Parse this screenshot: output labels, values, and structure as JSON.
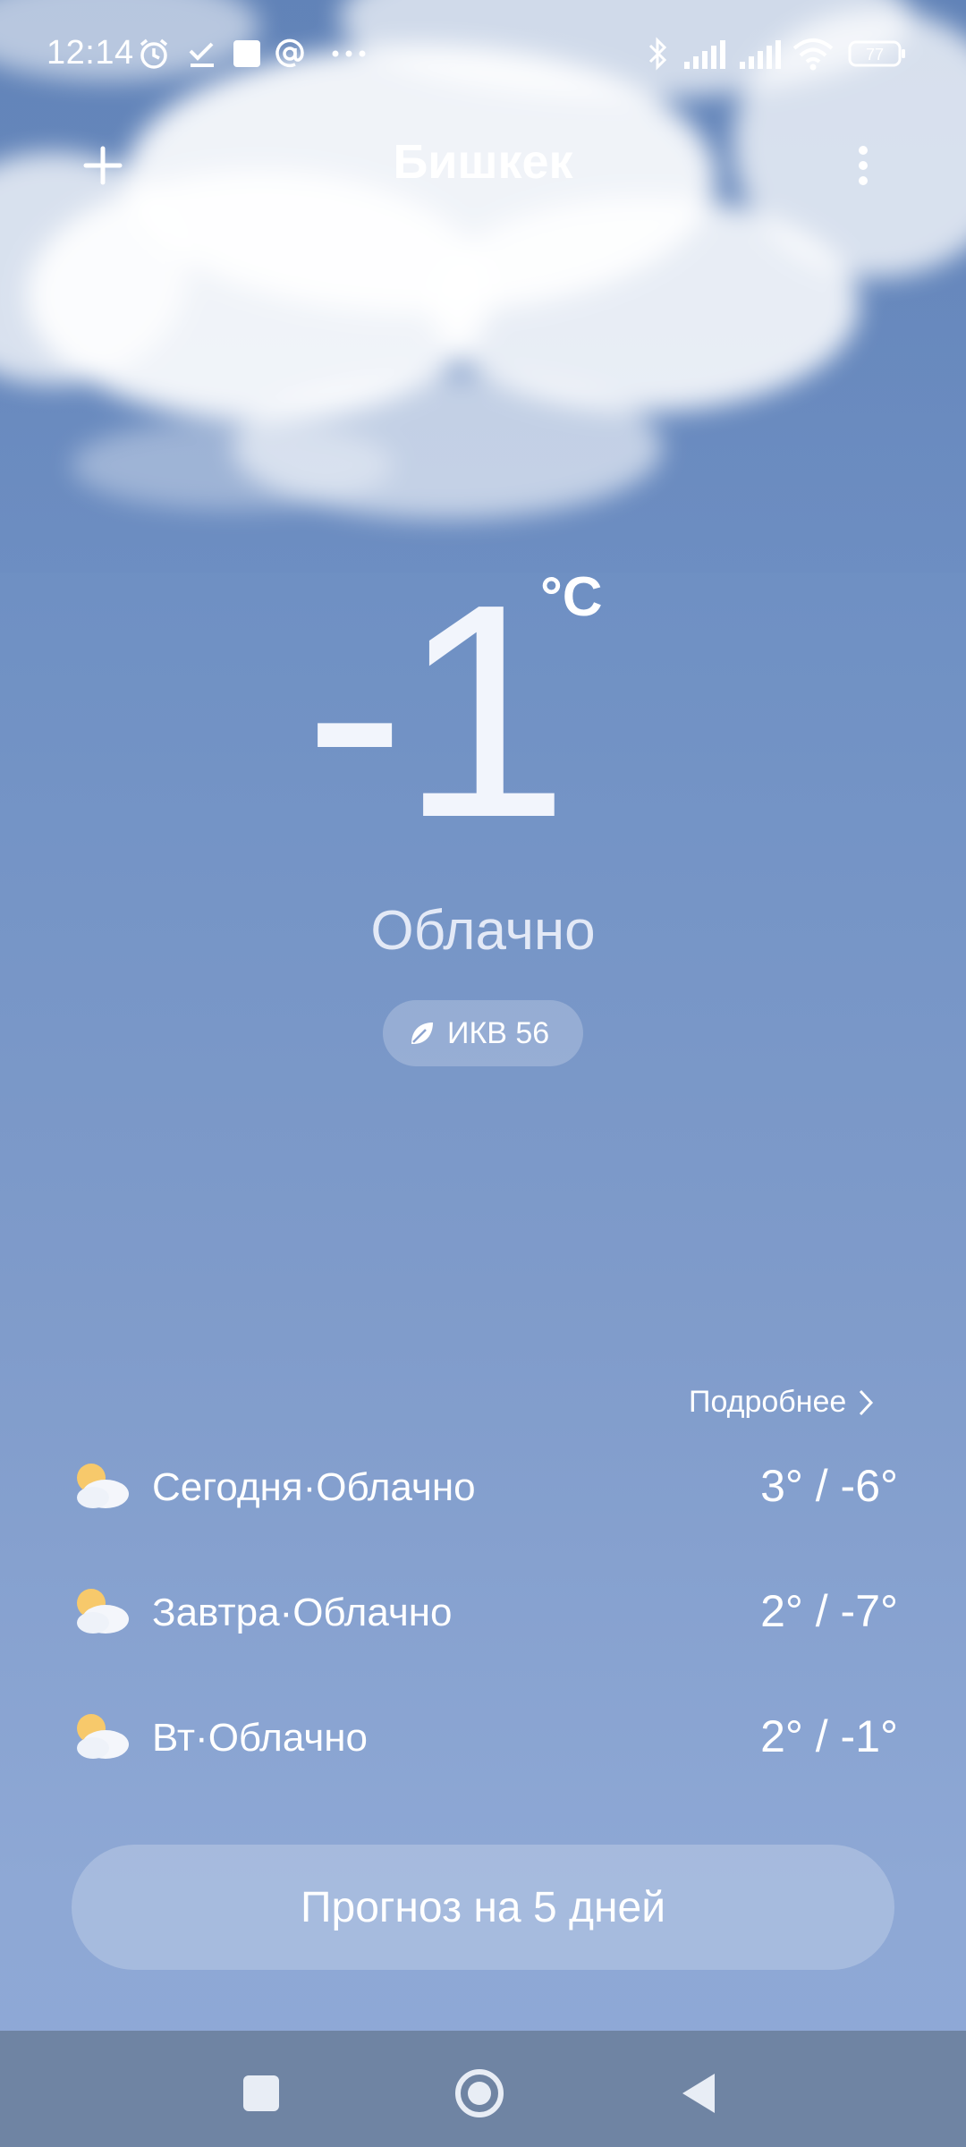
{
  "status_bar": {
    "time": "12:14",
    "battery": "77",
    "icons": [
      "alarm-icon",
      "checkmark-icon",
      "square-notification-icon",
      "at-icon",
      "more-notifications-icon",
      "bluetooth-icon",
      "signal-icon",
      "signal-icon",
      "wifi-icon",
      "battery-icon"
    ]
  },
  "header": {
    "city": "Бишкек",
    "add_icon": "plus-icon",
    "menu_icon": "vertical-dots-icon"
  },
  "current": {
    "temperature": "-1",
    "unit": "°C",
    "condition": "Облачно",
    "aqi_label": "ИКВ 56"
  },
  "forecast": {
    "details_label": "Подробнее",
    "days": [
      {
        "label": "Сегодня·Облачно",
        "temps": "3° / -6°",
        "icon": "partly-cloudy-icon"
      },
      {
        "label": "Завтра·Облачно",
        "temps": "2° / -7°",
        "icon": "partly-cloudy-icon"
      },
      {
        "label": "Вт·Облачно",
        "temps": "2° / -1°",
        "icon": "partly-cloudy-icon"
      }
    ],
    "five_day_button": "Прогноз на 5 дней"
  },
  "colors": {
    "sky_top": "#6385b9",
    "sky_bottom": "#8fa8d6",
    "nav_bar": "#6f84a3"
  }
}
